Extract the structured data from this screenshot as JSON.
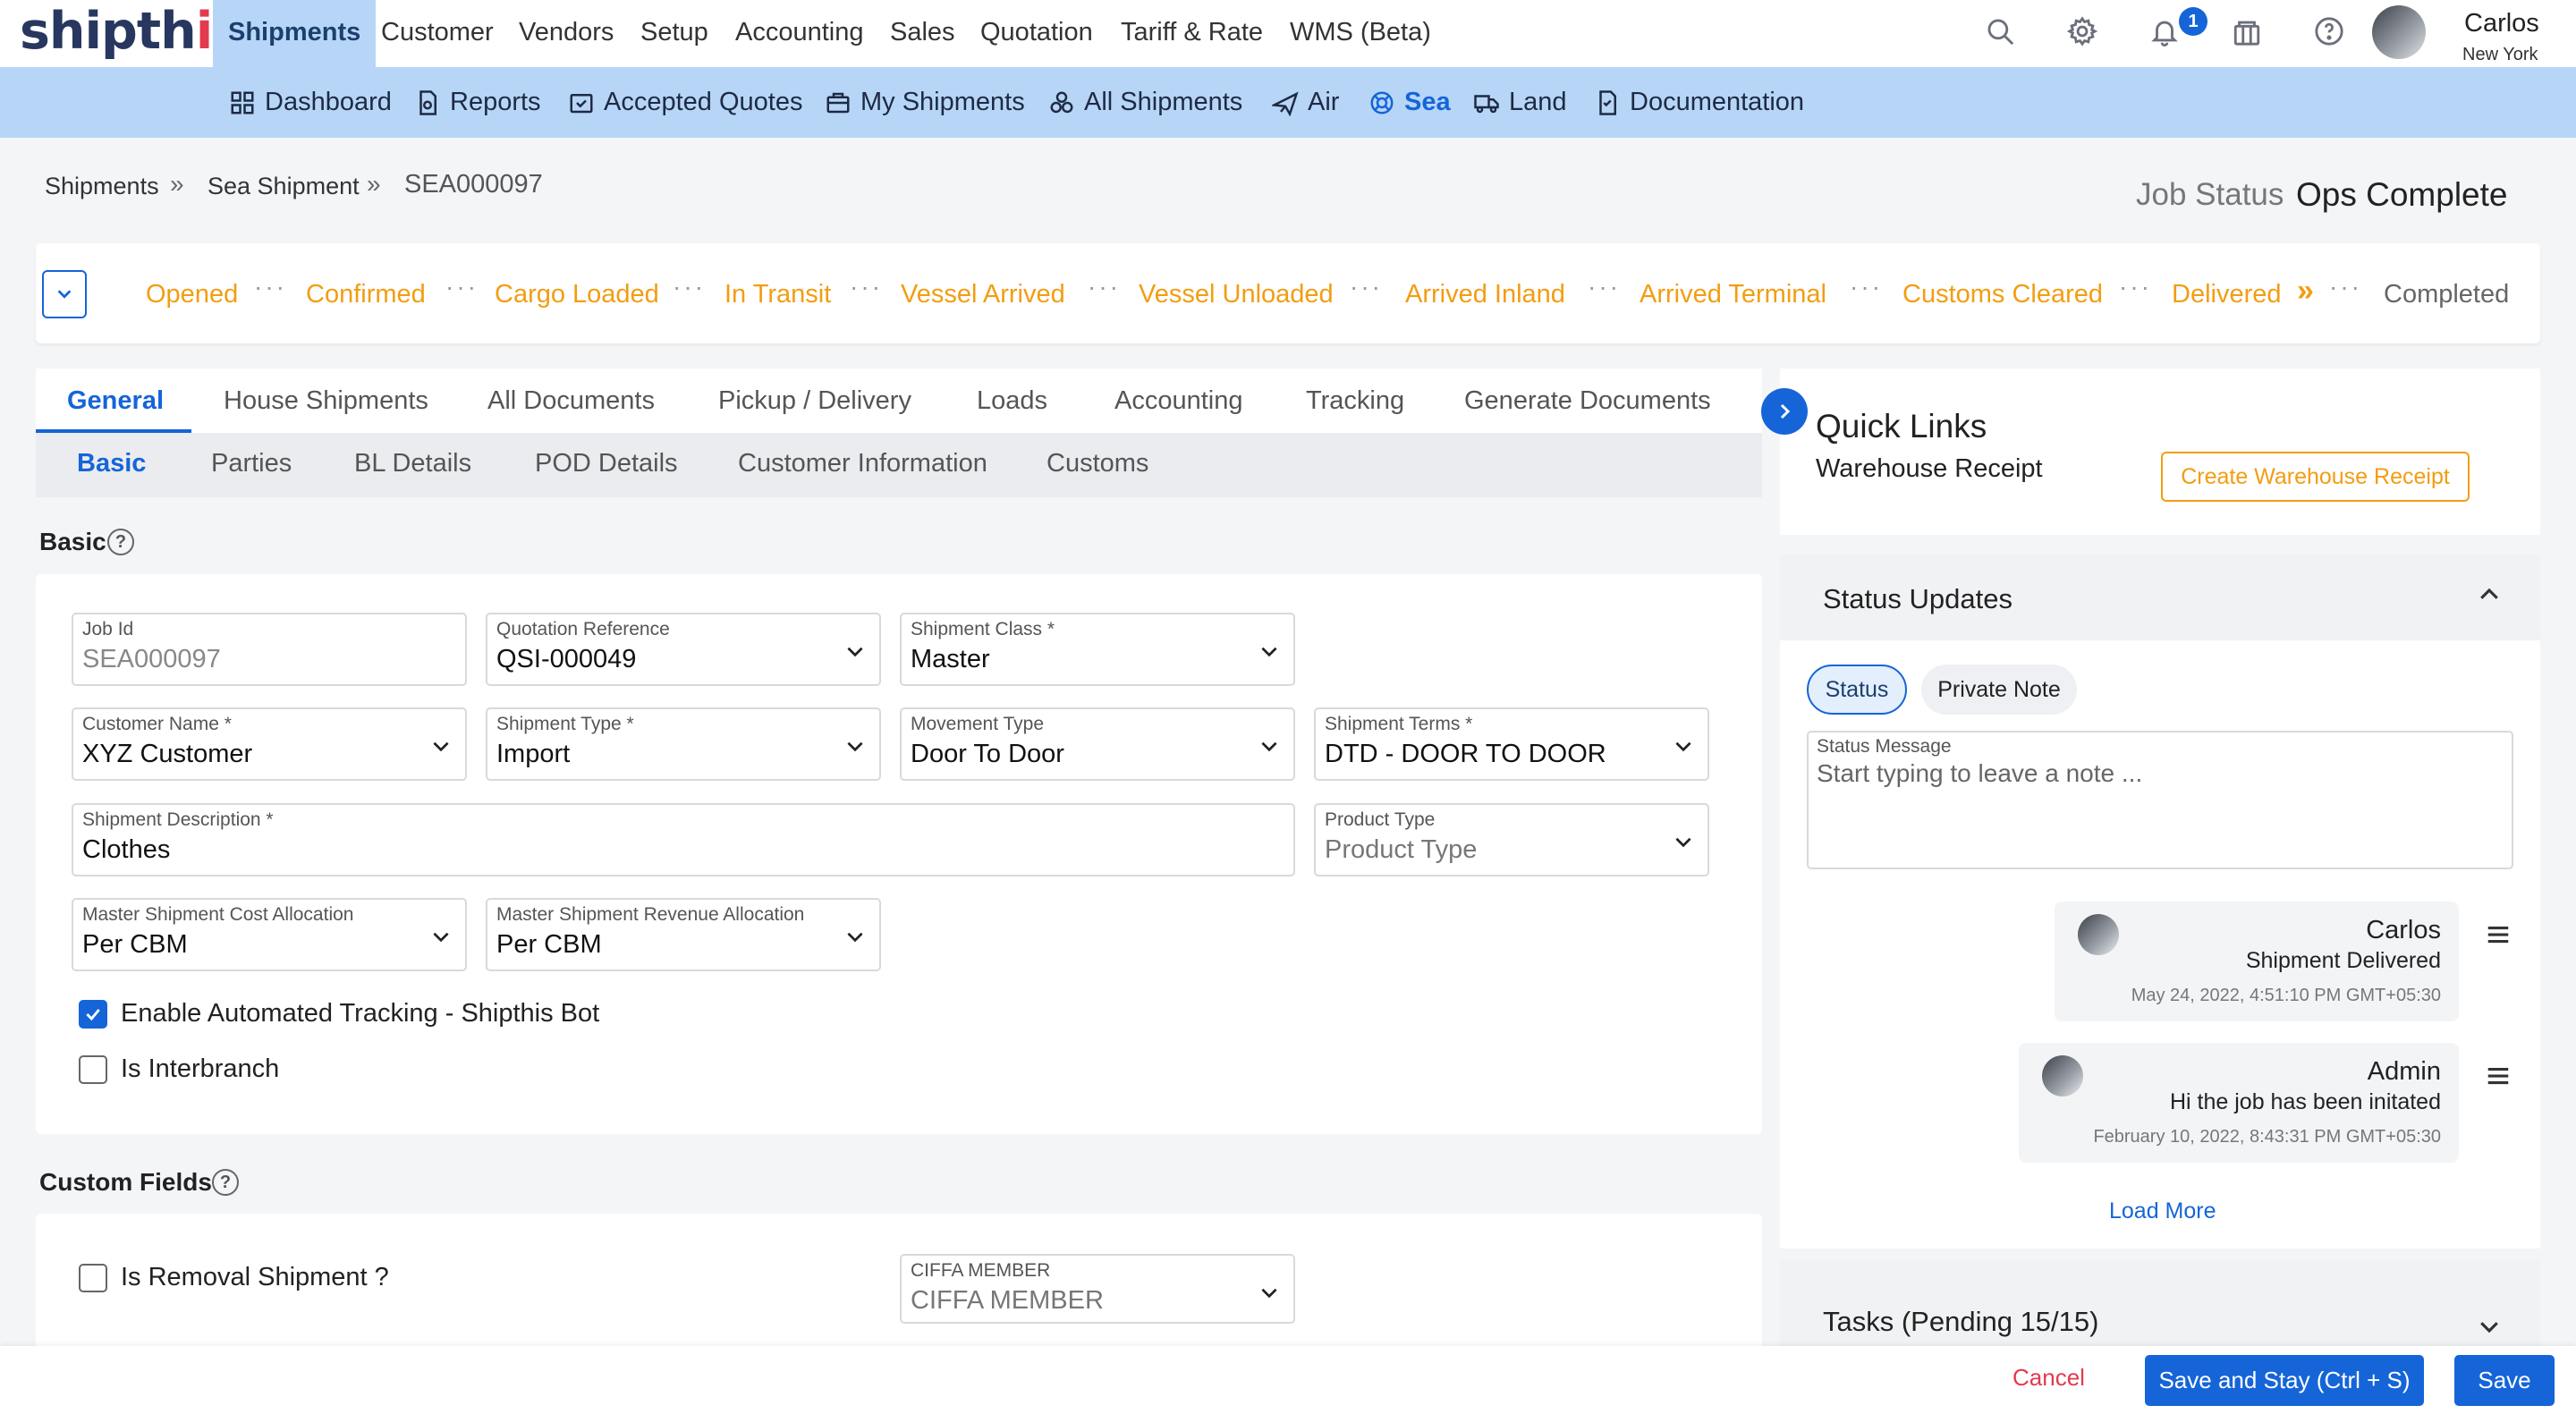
{
  "app": {
    "logo_text": "shipthis",
    "logo_main": "shipth",
    "logo_accent": "is"
  },
  "top_menu": [
    "Shipments",
    "Customer",
    "Vendors",
    "Setup",
    "Accounting",
    "Sales",
    "Quotation",
    "Tariff & Rate",
    "WMS (Beta)"
  ],
  "top_icons": [
    "search-icon",
    "gear-icon",
    "bell-icon",
    "gift-icon",
    "help-icon"
  ],
  "notification_count": "1",
  "user": {
    "name": "Carlos",
    "city": "New York"
  },
  "sub_menu": [
    {
      "label": "Dashboard",
      "icon": "grid-icon"
    },
    {
      "label": "Reports",
      "icon": "report-icon"
    },
    {
      "label": "Accepted Quotes",
      "icon": "inbox-check-icon"
    },
    {
      "label": "My Shipments",
      "icon": "briefcase-icon"
    },
    {
      "label": "All Shipments",
      "icon": "boxes-icon"
    },
    {
      "label": "Air",
      "icon": "plane-icon"
    },
    {
      "label": "Sea",
      "icon": "lifebuoy-icon"
    },
    {
      "label": "Land",
      "icon": "truck-icon"
    },
    {
      "label": "Documentation",
      "icon": "document-icon"
    }
  ],
  "breadcrumb": [
    "Shipments",
    "Sea Shipment",
    "SEA000097"
  ],
  "job_status": {
    "label": "Job Status",
    "value": "Ops Complete"
  },
  "stages": [
    "Opened",
    "Confirmed",
    "Cargo Loaded",
    "In Transit",
    "Vessel Arrived",
    "Vessel Unloaded",
    "Arrived Inland",
    "Arrived Terminal",
    "Customs Cleared",
    "Delivered",
    "Completed"
  ],
  "tabs": [
    "General",
    "House Shipments",
    "All Documents",
    "Pickup / Delivery",
    "Loads",
    "Accounting",
    "Tracking",
    "Generate Documents"
  ],
  "sub_tabs": [
    "Basic",
    "Parties",
    "BL Details",
    "POD Details",
    "Customer Information",
    "Customs"
  ],
  "basic": {
    "title": "Basic",
    "fields": {
      "job_id": {
        "label": "Job Id",
        "value": "SEA000097"
      },
      "quotation_reference": {
        "label": "Quotation Reference",
        "value": "QSI-000049"
      },
      "shipment_class": {
        "label": "Shipment Class *",
        "value": "Master"
      },
      "customer_name": {
        "label": "Customer Name *",
        "value": "XYZ Customer"
      },
      "shipment_type": {
        "label": "Shipment Type *",
        "value": "Import"
      },
      "movement_type": {
        "label": "Movement Type",
        "value": "Door To Door"
      },
      "shipment_terms": {
        "label": "Shipment Terms *",
        "value": "DTD - DOOR TO DOOR"
      },
      "shipment_description": {
        "label": "Shipment Description *",
        "value": "Clothes"
      },
      "product_type": {
        "label": "Product Type",
        "placeholder": "Product Type"
      },
      "cost_allocation": {
        "label": "Master Shipment Cost Allocation",
        "value": "Per CBM"
      },
      "revenue_allocation": {
        "label": "Master Shipment Revenue Allocation",
        "value": "Per CBM"
      }
    },
    "checkboxes": {
      "automated_tracking": {
        "label": "Enable Automated Tracking - Shipthis Bot",
        "checked": true
      },
      "interbranch": {
        "label": "Is Interbranch",
        "checked": false
      }
    }
  },
  "custom_fields": {
    "title": "Custom Fields",
    "removal": {
      "label": "Is Removal Shipment ?",
      "checked": false
    },
    "ciffa": {
      "label": "CIFFA MEMBER",
      "placeholder": "CIFFA MEMBER"
    }
  },
  "quick_links": {
    "title": "Quick Links",
    "item": "Warehouse Receipt",
    "button": "Create Warehouse Receipt"
  },
  "status_updates": {
    "title": "Status Updates",
    "pills": [
      "Status",
      "Private Note"
    ],
    "message_label": "Status Message",
    "message_placeholder": "Start typing to leave a note ...",
    "notes": [
      {
        "author": "Carlos",
        "message": "Shipment Delivered",
        "time": "May 24, 2022, 4:51:10 PM GMT+05:30"
      },
      {
        "author": "Admin",
        "message": "Hi the job has been initated",
        "time": "February 10, 2022, 8:43:31 PM GMT+05:30"
      }
    ],
    "load_more": "Load More"
  },
  "tasks": {
    "title": "Tasks (Pending 15/15)"
  },
  "footer": {
    "cancel": "Cancel",
    "save_stay": "Save and Stay (Ctrl + S)",
    "save": "Save"
  },
  "colors": {
    "primary": "#1565d8",
    "accent": "#f29d11",
    "danger": "#e23a4f",
    "nav_bg": "#b7d6f7"
  }
}
